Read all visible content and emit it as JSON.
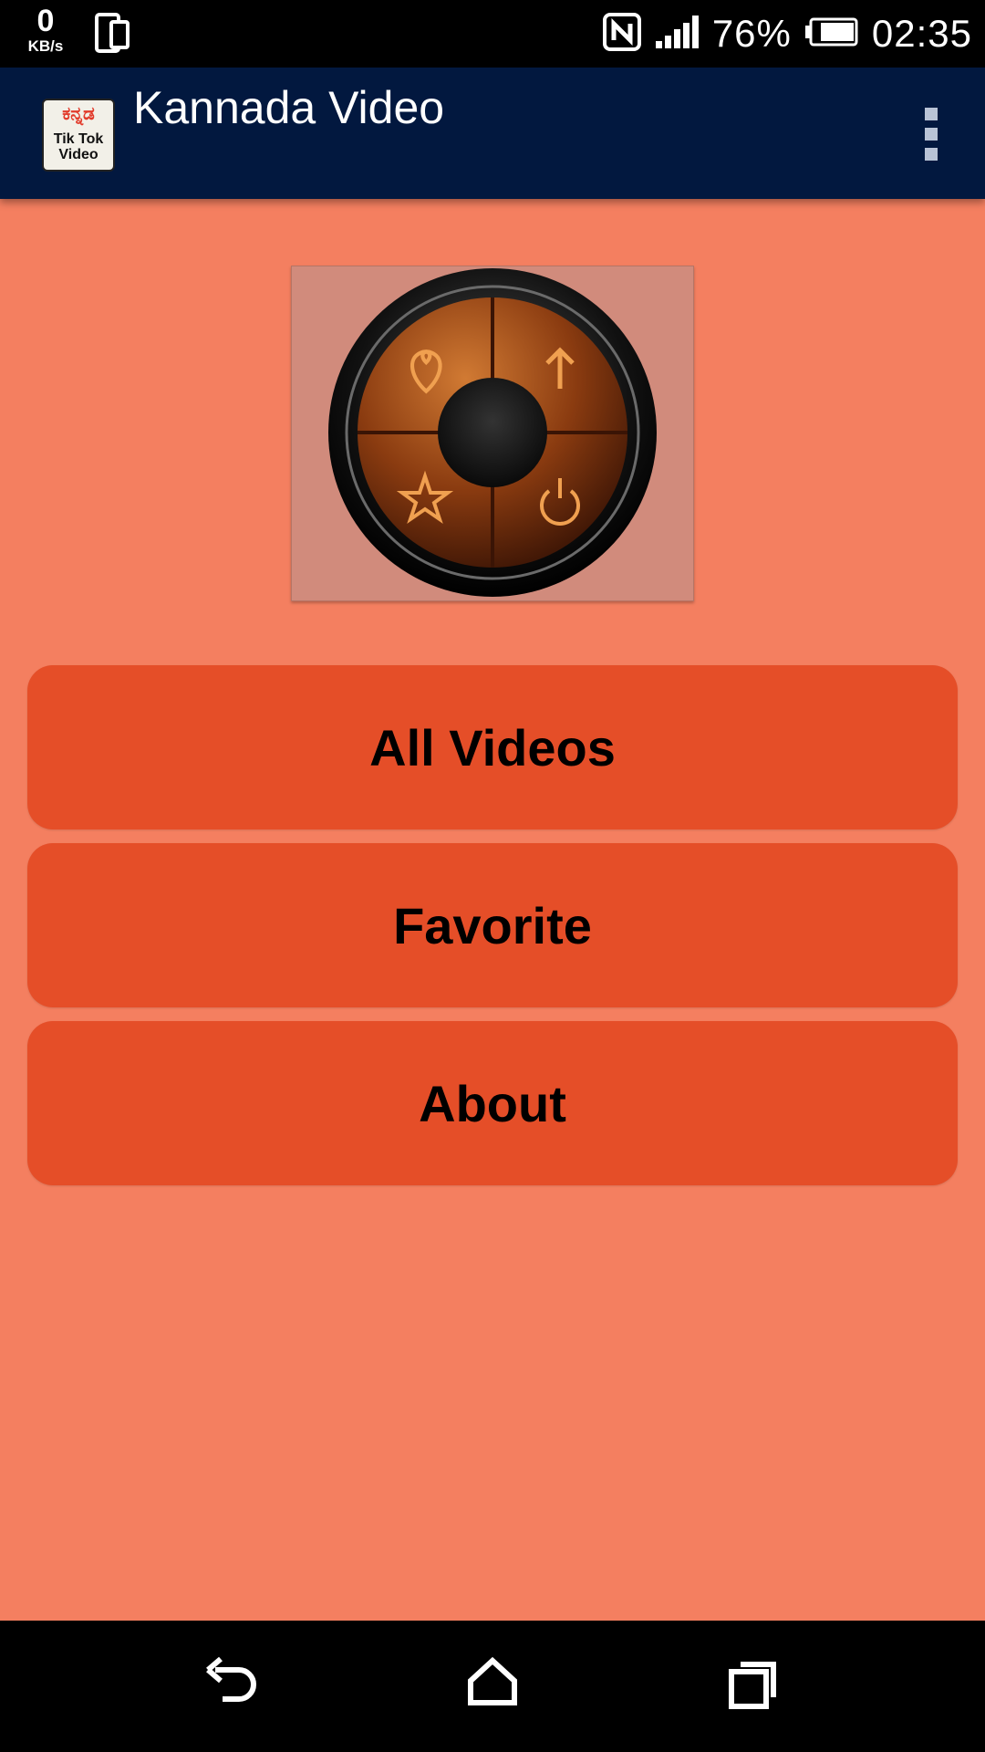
{
  "status_bar": {
    "net_speed_value": "0",
    "net_speed_unit": "KB/s",
    "battery_percent": "76%",
    "time": "02:35",
    "icons": [
      "phone-device-icon",
      "nfc-icon",
      "signal-icon",
      "battery-icon"
    ]
  },
  "app_bar": {
    "logo_text_top": "ಕನ್ನಡ",
    "logo_text_bottom": "Tik Tok Video",
    "title": "Kannada Video",
    "menu_icon": "more-vert-icon",
    "background_color": "#02183F"
  },
  "hero": {
    "icons": [
      "heart-icon",
      "arrow-up-icon",
      "star-icon",
      "power-icon"
    ]
  },
  "menu": {
    "buttons": [
      {
        "label": "All Videos"
      },
      {
        "label": "Favorite"
      },
      {
        "label": "About"
      }
    ],
    "button_color": "#E54E28",
    "page_background": "#F47F60"
  },
  "nav_bar": {
    "icons": [
      "back-icon",
      "home-icon",
      "recents-icon"
    ]
  }
}
